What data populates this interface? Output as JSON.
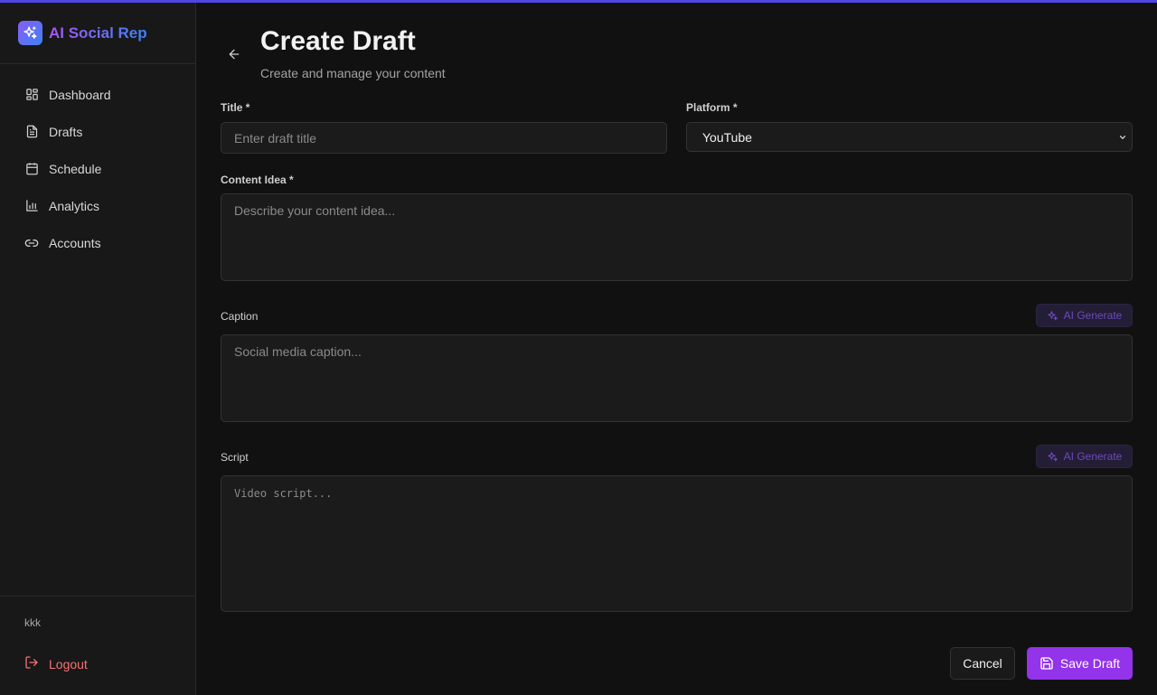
{
  "brand": {
    "name": "AI Social Rep"
  },
  "sidebar": {
    "items": [
      {
        "label": "Dashboard",
        "icon": "dashboard-icon"
      },
      {
        "label": "Drafts",
        "icon": "file-icon"
      },
      {
        "label": "Schedule",
        "icon": "calendar-icon"
      },
      {
        "label": "Analytics",
        "icon": "bar-chart-icon"
      },
      {
        "label": "Accounts",
        "icon": "link-icon"
      }
    ],
    "user": "kkk",
    "logout_label": "Logout"
  },
  "header": {
    "title": "Create Draft",
    "subtitle": "Create and manage your content"
  },
  "form": {
    "title_label": "Title *",
    "title_placeholder": "Enter draft title",
    "platform_label": "Platform *",
    "platform_value": "YouTube",
    "content_label": "Content Idea *",
    "content_placeholder": "Describe your content idea...",
    "caption_label": "Caption",
    "caption_placeholder": "Social media caption...",
    "script_label": "Script",
    "script_placeholder": "Video script...",
    "ai_generate_label": "AI Generate"
  },
  "actions": {
    "cancel_label": "Cancel",
    "save_label": "Save Draft"
  },
  "colors": {
    "accent": "#9333ea",
    "top_bar": "#4f46e5",
    "logout": "#f87171"
  }
}
